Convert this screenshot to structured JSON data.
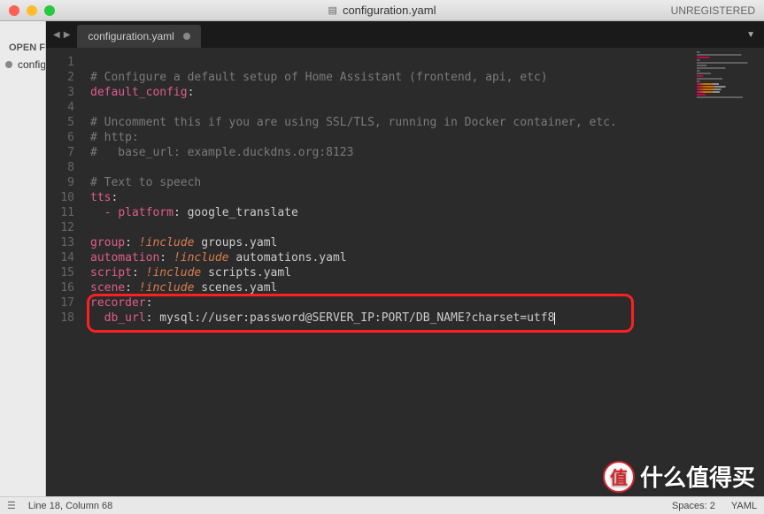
{
  "titlebar": {
    "filename": "configuration.yaml",
    "registration": "UNREGISTERED"
  },
  "sidebar": {
    "header": "OPEN FILES",
    "items": [
      {
        "label": "configuration.yaml"
      }
    ]
  },
  "tab": {
    "label": "configuration.yaml"
  },
  "code": {
    "lines": [
      {
        "n": 1,
        "tokens": []
      },
      {
        "n": 2,
        "tokens": [
          {
            "t": "comment",
            "v": "# Configure a default setup of Home Assistant (frontend, api, etc)"
          }
        ]
      },
      {
        "n": 3,
        "tokens": [
          {
            "t": "key",
            "v": "default_config"
          },
          {
            "t": "punct",
            "v": ":"
          }
        ]
      },
      {
        "n": 4,
        "tokens": []
      },
      {
        "n": 5,
        "tokens": [
          {
            "t": "comment",
            "v": "# Uncomment this if you are using SSL/TLS, running in Docker container, etc."
          }
        ]
      },
      {
        "n": 6,
        "tokens": [
          {
            "t": "comment",
            "v": "# http:"
          }
        ]
      },
      {
        "n": 7,
        "tokens": [
          {
            "t": "comment",
            "v": "#   base_url: example.duckdns.org:8123"
          }
        ]
      },
      {
        "n": 8,
        "tokens": []
      },
      {
        "n": 9,
        "tokens": [
          {
            "t": "comment",
            "v": "# Text to speech"
          }
        ]
      },
      {
        "n": 10,
        "tokens": [
          {
            "t": "key",
            "v": "tts"
          },
          {
            "t": "punct",
            "v": ":"
          }
        ]
      },
      {
        "n": 11,
        "tokens": [
          {
            "t": "indent",
            "v": "  "
          },
          {
            "t": "li",
            "v": "- "
          },
          {
            "t": "key",
            "v": "platform"
          },
          {
            "t": "punct",
            "v": ": "
          },
          {
            "t": "val",
            "v": "google_translate"
          }
        ]
      },
      {
        "n": 12,
        "tokens": []
      },
      {
        "n": 13,
        "tokens": [
          {
            "t": "key",
            "v": "group"
          },
          {
            "t": "punct",
            "v": ": "
          },
          {
            "t": "tag",
            "v": "!include"
          },
          {
            "t": "val",
            "v": " groups.yaml"
          }
        ]
      },
      {
        "n": 14,
        "tokens": [
          {
            "t": "key",
            "v": "automation"
          },
          {
            "t": "punct",
            "v": ": "
          },
          {
            "t": "tag",
            "v": "!include"
          },
          {
            "t": "val",
            "v": " automations.yaml"
          }
        ]
      },
      {
        "n": 15,
        "tokens": [
          {
            "t": "key",
            "v": "script"
          },
          {
            "t": "punct",
            "v": ": "
          },
          {
            "t": "tag",
            "v": "!include"
          },
          {
            "t": "val",
            "v": " scripts.yaml"
          }
        ]
      },
      {
        "n": 16,
        "tokens": [
          {
            "t": "key",
            "v": "scene"
          },
          {
            "t": "punct",
            "v": ": "
          },
          {
            "t": "tag",
            "v": "!include"
          },
          {
            "t": "val",
            "v": " scenes.yaml"
          }
        ]
      },
      {
        "n": 17,
        "tokens": [
          {
            "t": "key",
            "v": "recorder"
          },
          {
            "t": "punct",
            "v": ":"
          }
        ]
      },
      {
        "n": 18,
        "tokens": [
          {
            "t": "indent",
            "v": "  "
          },
          {
            "t": "key",
            "v": "db_url"
          },
          {
            "t": "punct",
            "v": ": "
          },
          {
            "t": "val",
            "v": "mysql://user:password@SERVER_IP:PORT/DB_NAME?charset=utf8"
          }
        ],
        "cursor": true
      }
    ]
  },
  "statusbar": {
    "position": "Line 18, Column 68",
    "spaces": "Spaces: 2",
    "syntax": "YAML"
  },
  "watermark": {
    "logo": "值",
    "text": "什么值得买"
  }
}
